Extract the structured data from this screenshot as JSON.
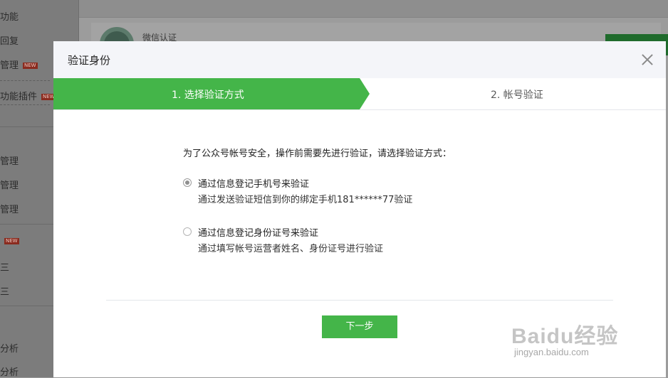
{
  "background": {
    "sidebar_items": [
      {
        "label": "功能",
        "new": false
      },
      {
        "label": "回复",
        "new": false
      },
      {
        "label": "管理",
        "new": true
      },
      {
        "label": "功能插件",
        "new": true
      },
      {
        "label": "管理",
        "new": false
      },
      {
        "label": "管理",
        "new": false
      },
      {
        "label": "管理",
        "new": false
      },
      {
        "label": "",
        "new": true
      },
      {
        "label": "三",
        "new": false
      },
      {
        "label": "三",
        "new": false
      },
      {
        "label": "分析",
        "new": false
      },
      {
        "label": "分析",
        "new": false
      }
    ],
    "new_badge": "NEW",
    "card_title": "微信认证"
  },
  "dialog": {
    "title": "验证身份",
    "steps": [
      {
        "label": "1. 选择验证方式",
        "active": true
      },
      {
        "label": "2. 帐号验证",
        "active": false
      }
    ],
    "prompt": "为了公众号帐号安全，操作前需要先进行验证，请选择验证方式：",
    "options": [
      {
        "title": "通过信息登记手机号来验证",
        "desc": "通过发送验证短信到你的绑定手机181******77验证",
        "checked": true
      },
      {
        "title": "通过信息登记身份证号来验证",
        "desc": "通过填写帐号运营者姓名、身份证号进行验证",
        "checked": false
      }
    ],
    "next_button": "下一步"
  },
  "watermark": {
    "logo": "Baidu经验",
    "url": "jingyan.baidu.com"
  },
  "colors": {
    "accent": "#44b549",
    "overlay": "#9a9a9a"
  }
}
